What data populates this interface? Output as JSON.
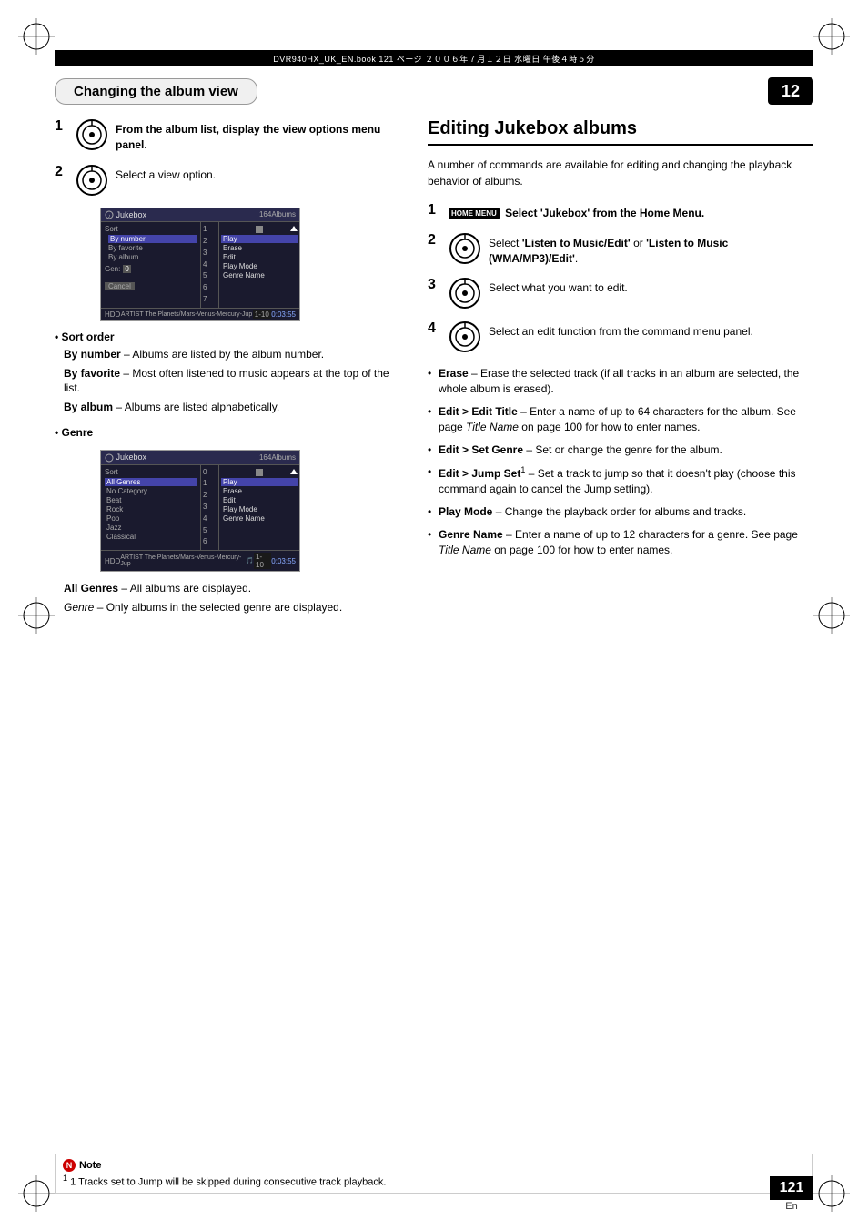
{
  "page": {
    "chapter": "12",
    "page_number": "121",
    "page_lang": "En",
    "header_strip_text": "DVR940HX_UK_EN.book  121 ページ  ２００６年７月１２日  水曜日  午後４時５分"
  },
  "left_section": {
    "heading": "Changing the album view",
    "step1": {
      "number": "1",
      "text": "From the album list, display the view options menu panel."
    },
    "step2": {
      "number": "2",
      "text": "Select a view option."
    },
    "screenshot1": {
      "header_title": "Jukebox",
      "header_count": "164Albums",
      "sort_label": "Sort",
      "sort_options": [
        "By number",
        "By favorite",
        "By album"
      ],
      "genre_label": "Gen:",
      "cancel_label": "Cancel",
      "list_items": [
        "1",
        "2",
        "3",
        "4",
        "5",
        "6",
        "7"
      ],
      "menu_items": [
        "Play",
        "Erase",
        "Edit",
        "Play Mode",
        "Genre Name"
      ],
      "footer_left": "HDD",
      "footer_mid": "ARTIST The Planets/Mars-Venus-Mercury-Jup",
      "footer_range": "1-10",
      "footer_time": "0:03:55"
    },
    "sort_order_heading": "Sort order",
    "sort_bullets": [
      {
        "label": "By number",
        "text": "– Albums are listed by the album number."
      },
      {
        "label": "By favorite",
        "text": "– Most often listened to music appears at the top of the list."
      },
      {
        "label": "By album",
        "text": "– Albums are listed alphabetically."
      }
    ],
    "genre_heading": "Genre",
    "screenshot2": {
      "header_title": "Jukebox",
      "header_count": "164Albums",
      "sort_label": "Sort",
      "genre_list_items": [
        "All Genres",
        "No Category",
        "Beat",
        "Rock",
        "Pop",
        "Jazz",
        "Classical"
      ],
      "menu_items": [
        "Play",
        "Erase",
        "Edit",
        "Play Mode",
        "Genre Name"
      ],
      "footer_left": "HDD",
      "footer_mid": "ARTIST The Planets/Mars-Venus-Mercury-Jup",
      "footer_range": "1-10",
      "footer_time": "0:03:55"
    },
    "genre_bullets": [
      {
        "label": "All Genres",
        "text": "– All albums are displayed."
      },
      {
        "label": "Genre",
        "italic": true,
        "text": "– Only albums in the selected genre are displayed."
      }
    ]
  },
  "right_section": {
    "heading": "Editing Jukebox albums",
    "intro": "A number of commands are available for editing and changing the playback behavior of albums.",
    "step1": {
      "number": "1",
      "home_menu_badge": "HOME MENU",
      "text": "Select 'Jukebox' from the Home Menu."
    },
    "step2": {
      "number": "2",
      "text": "Select 'Listen to Music/Edit' or 'Listen to Music (WMA/MP3)/Edit'."
    },
    "step3": {
      "number": "3",
      "text": "Select what you want to edit."
    },
    "step4": {
      "number": "4",
      "text": "Select an edit function from the command menu panel."
    },
    "bullets": [
      {
        "label": "Erase",
        "text": "– Erase the selected track (if all tracks in an album are selected, the whole album is erased)."
      },
      {
        "label": "Edit > Edit Title",
        "text": "– Enter a name of up to 64 characters for the album. See page ",
        "italic_part": "Title Name",
        "text2": " on page 100 for how to enter names."
      },
      {
        "label": "Edit > Set Genre",
        "text": "– Set or change the genre for the album."
      },
      {
        "label": "Edit > Jump Set",
        "superscript": "1",
        "text": "– Set a track to jump so that it doesn't play (choose this command again to cancel the Jump setting)."
      },
      {
        "label": "Play Mode",
        "text": "– Change the playback order for albums and tracks."
      },
      {
        "label": "Genre Name",
        "text": "– Enter a name of up to 12 characters for a genre. See page ",
        "italic_part": "Title Name",
        "text2": " on page 100 for how to enter names."
      }
    ]
  },
  "note": {
    "heading": "Note",
    "items": [
      "1  Tracks set to Jump will be skipped during consecutive track playback."
    ]
  }
}
